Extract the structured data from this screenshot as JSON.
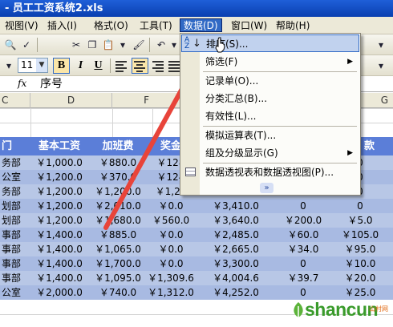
{
  "window": {
    "title": "- 员工工资系统2.xls"
  },
  "menubar": {
    "items": [
      {
        "label": "视图(V)"
      },
      {
        "label": "插入(I)"
      },
      {
        "label": "格式(O)"
      },
      {
        "label": "工具(T)"
      },
      {
        "label": "数据(D)"
      },
      {
        "label": "窗口(W)"
      },
      {
        "label": "帮助(H)"
      }
    ]
  },
  "format_toolbar": {
    "font_size": "11",
    "bold": "B",
    "italic": "I",
    "underline": "U"
  },
  "formula_bar": {
    "fx": "fx",
    "content": "序号"
  },
  "columns": [
    "C",
    "D",
    "F",
    "G"
  ],
  "sheet": {
    "headers": [
      "门",
      "基本工资",
      "加班费",
      "奖金",
      "",
      "",
      "款"
    ],
    "rows": [
      [
        "务部",
        "￥1,000.0",
        "￥880.0",
        "￥128",
        "",
        "",
        "0"
      ],
      [
        "公室",
        "￥1,200.0",
        "￥370.0",
        "￥124",
        "",
        "",
        "0"
      ],
      [
        "务部",
        "￥1,200.0",
        "￥1,200.0",
        "￥1,21",
        "",
        "",
        "0"
      ],
      [
        "划部",
        "￥1,200.0",
        "￥2,010.0",
        "￥0.0",
        "￥3,410.0",
        "0",
        "0"
      ],
      [
        "划部",
        "￥1,200.0",
        "￥1,680.0",
        "￥560.0",
        "￥3,640.0",
        "￥200.0",
        "￥5.0"
      ],
      [
        "事部",
        "￥1,400.0",
        "￥885.0",
        "￥0.0",
        "￥2,485.0",
        "￥60.0",
        "￥105.0"
      ],
      [
        "事部",
        "￥1,400.0",
        "￥1,065.0",
        "￥0.0",
        "￥2,665.0",
        "￥34.0",
        "￥95.0"
      ],
      [
        "事部",
        "￥1,400.0",
        "￥1,700.0",
        "￥0.0",
        "￥3,300.0",
        "0",
        "￥10.0"
      ],
      [
        "事部",
        "￥1,400.0",
        "￥1,095.0",
        "￥1,309.6",
        "￥4,004.6",
        "￥39.7",
        "￥20.0"
      ],
      [
        "公室",
        "￥2,000.0",
        "￥740.0",
        "￥1,312.0",
        "￥4,252.0",
        "0",
        "￥25.0"
      ]
    ]
  },
  "data_menu": {
    "items": [
      {
        "label": "排序(S)...",
        "icon": "sort-ascending-icon",
        "highlighted": true
      },
      {
        "label": "筛选(F)",
        "submenu": true
      },
      {
        "label": "记录单(O)..."
      },
      {
        "label": "分类汇总(B)..."
      },
      {
        "label": "有效性(L)..."
      },
      {
        "label": "模拟运算表(T)..."
      },
      {
        "label": "组及分级显示(G)",
        "submenu": true
      },
      {
        "label": "数据透视表和数据透视图(P)...",
        "icon": "pivot-table-icon"
      }
    ],
    "more_glyph": "»"
  },
  "watermark": {
    "text": "shancun",
    "sub": "山村网"
  },
  "colors": {
    "header_row": "#5b7ed8",
    "row_a": "#b8c7e6",
    "row_b": "#a8bae2",
    "menu_highlight": "#c1d2ee",
    "arrow": "#e8443a",
    "titlebar": "#1f5fd8"
  }
}
